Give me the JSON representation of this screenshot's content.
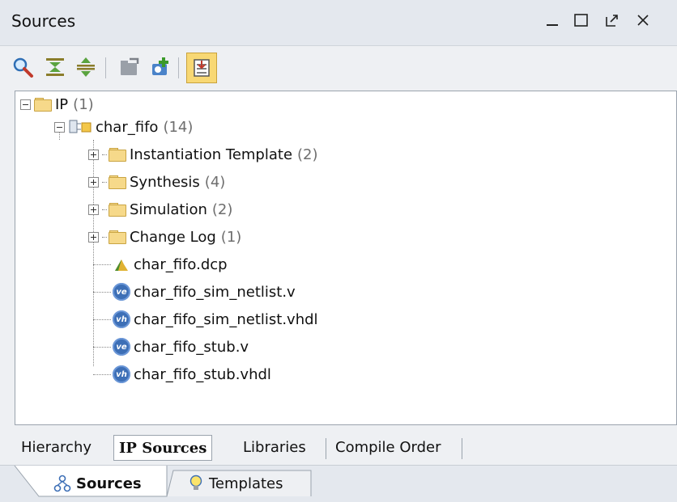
{
  "panel": {
    "title": "Sources",
    "controls": {
      "minimize": "_",
      "maximize": "☐",
      "float": "⇱",
      "close": "✕"
    }
  },
  "toolbar": {
    "buttons": [
      "search-icon",
      "collapse-all-icon",
      "expand-all-icon",
      "open-file-icon",
      "add-sources-icon",
      "show-all-toggle-icon"
    ]
  },
  "tree": {
    "root": {
      "label": "IP",
      "count": "(1)"
    },
    "ip": {
      "label": "char_fifo",
      "count": "(14)"
    },
    "folders": [
      {
        "label": "Instantiation Template",
        "count": "(2)"
      },
      {
        "label": "Synthesis",
        "count": "(4)"
      },
      {
        "label": "Simulation",
        "count": "(2)"
      },
      {
        "label": "Change Log",
        "count": "(1)"
      }
    ],
    "files": [
      {
        "label": "char_fifo.dcp",
        "icon": "dcp-icon"
      },
      {
        "label": "char_fifo_sim_netlist.v",
        "icon": "verilog-icon",
        "badge": "ve"
      },
      {
        "label": "char_fifo_sim_netlist.vhdl",
        "icon": "vhdl-icon",
        "badge": "vh"
      },
      {
        "label": "char_fifo_stub.v",
        "icon": "verilog-icon",
        "badge": "ve"
      },
      {
        "label": "char_fifo_stub.vhdl",
        "icon": "vhdl-icon",
        "badge": "vh"
      }
    ]
  },
  "subtabs": [
    "Hierarchy",
    "IP Sources",
    "Libraries",
    "Compile Order"
  ],
  "active_subtab": "IP Sources",
  "views": [
    {
      "label": "Sources",
      "active": true
    },
    {
      "label": "Templates",
      "active": false
    }
  ]
}
